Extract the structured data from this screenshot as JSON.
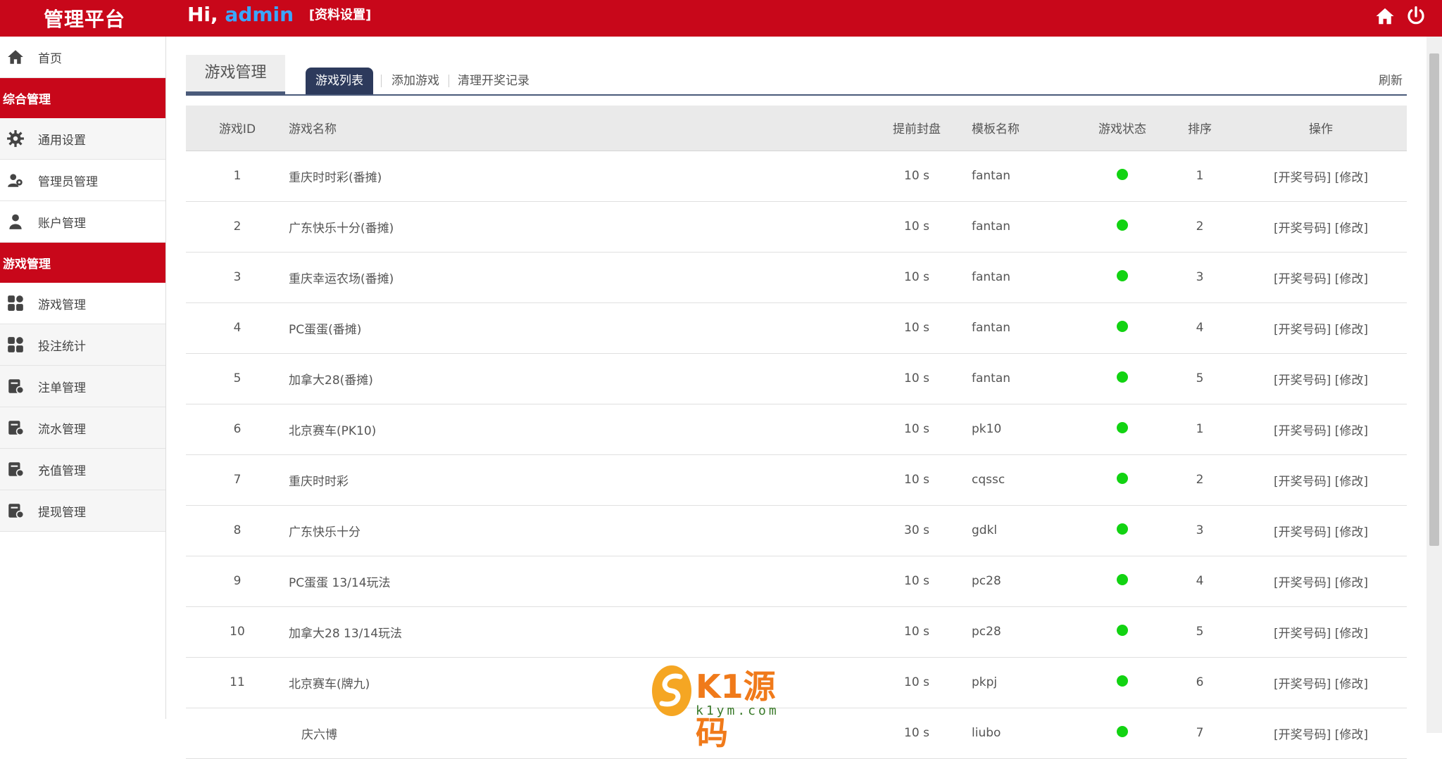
{
  "header": {
    "brand": "管理平台",
    "greeting_prefix": "Hi,",
    "username": "admin",
    "profile_link": "[资料设置]",
    "icons": [
      "home-icon",
      "power-icon"
    ]
  },
  "sidebar": {
    "items": [
      {
        "type": "item",
        "label": "首页",
        "icon": "home-icon"
      },
      {
        "type": "group",
        "label": "综合管理"
      },
      {
        "type": "item",
        "label": "通用设置",
        "icon": "gear-icon"
      },
      {
        "type": "item",
        "label": "管理员管理",
        "icon": "users-icon"
      },
      {
        "type": "item",
        "label": "账户管理",
        "icon": "user-icon"
      },
      {
        "type": "group",
        "label": "游戏管理"
      },
      {
        "type": "item",
        "label": "游戏管理",
        "icon": "grid-icon"
      },
      {
        "type": "item",
        "label": "投注统计",
        "icon": "grid-icon"
      },
      {
        "type": "item",
        "label": "注单管理",
        "icon": "ledger-icon"
      },
      {
        "type": "item",
        "label": "流水管理",
        "icon": "ledger-icon"
      },
      {
        "type": "item",
        "label": "充值管理",
        "icon": "ledger-icon"
      },
      {
        "type": "item",
        "label": "提现管理",
        "icon": "ledger-icon"
      }
    ]
  },
  "main": {
    "page_title": "游戏管理",
    "tabs": [
      {
        "label": "游戏列表",
        "active": true
      },
      {
        "label": "添加游戏",
        "active": false
      },
      {
        "label": "清理开奖记录",
        "active": false
      }
    ],
    "refresh_label": "刷新",
    "table": {
      "columns": [
        "游戏ID",
        "游戏名称",
        "提前封盘",
        "模板名称",
        "游戏状态",
        "排序",
        "操作"
      ],
      "rows": [
        {
          "id": "1",
          "name": "重庆时时彩(番摊)",
          "seal": "10 s",
          "template": "fantan",
          "status": "on",
          "sort": "1"
        },
        {
          "id": "2",
          "name": "广东快乐十分(番摊)",
          "seal": "10 s",
          "template": "fantan",
          "status": "on",
          "sort": "2"
        },
        {
          "id": "3",
          "name": "重庆幸运农场(番摊)",
          "seal": "10 s",
          "template": "fantan",
          "status": "on",
          "sort": "3"
        },
        {
          "id": "4",
          "name": "PC蛋蛋(番摊)",
          "seal": "10 s",
          "template": "fantan",
          "status": "on",
          "sort": "4"
        },
        {
          "id": "5",
          "name": "加拿大28(番摊)",
          "seal": "10 s",
          "template": "fantan",
          "status": "on",
          "sort": "5"
        },
        {
          "id": "6",
          "name": "北京赛车(PK10)",
          "seal": "10 s",
          "template": "pk10",
          "status": "on",
          "sort": "1"
        },
        {
          "id": "7",
          "name": "重庆时时彩",
          "seal": "10 s",
          "template": "cqssc",
          "status": "on",
          "sort": "2"
        },
        {
          "id": "8",
          "name": "广东快乐十分",
          "seal": "30 s",
          "template": "gdkl",
          "status": "on",
          "sort": "3"
        },
        {
          "id": "9",
          "name": "PC蛋蛋 13/14玩法",
          "seal": "10 s",
          "template": "pc28",
          "status": "on",
          "sort": "4"
        },
        {
          "id": "10",
          "name": "加拿大28 13/14玩法",
          "seal": "10 s",
          "template": "pc28",
          "status": "on",
          "sort": "5"
        },
        {
          "id": "11",
          "name": "北京赛车(牌九)",
          "seal": "10 s",
          "template": "pkpj",
          "status": "on",
          "sort": "6"
        },
        {
          "id": "",
          "name": "庆六博",
          "seal": "10 s",
          "template": "liubo",
          "status": "on",
          "sort": "7"
        }
      ],
      "op_draw": "[开奖号码]",
      "op_edit": "[修改]"
    }
  },
  "watermark": {
    "brand": "K1源码",
    "site": "k1ym.com"
  },
  "colors": {
    "header_red": "#c8071a",
    "username_blue": "#3aa6ff",
    "tab_active": "#2d3a5c",
    "status_green": "#12d312"
  }
}
